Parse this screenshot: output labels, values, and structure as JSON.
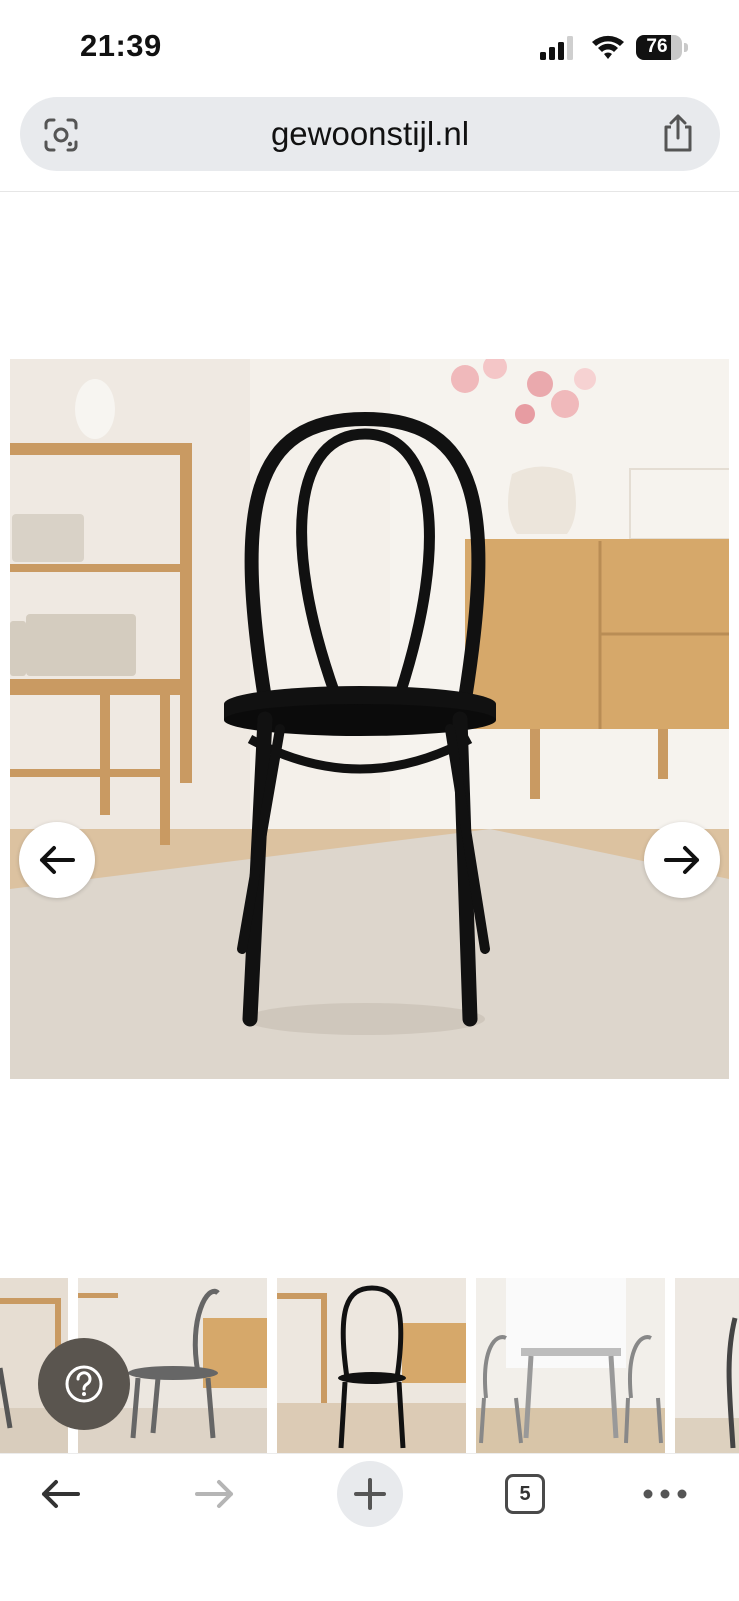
{
  "status_bar": {
    "time": "21:39",
    "battery_level": "76",
    "battery_fraction": 0.76
  },
  "address_bar": {
    "url": "gewoonstijl.nl"
  },
  "product": {
    "image_alt": "Black bentwood dining chair in living room",
    "gallery_prev_icon": "arrow-left-icon",
    "gallery_next_icon": "arrow-right-icon"
  },
  "thumbnails": {
    "count_visible": 5,
    "selected_index": 2
  },
  "help": {
    "icon": "question-icon"
  },
  "toolbar": {
    "tab_count": "5"
  },
  "colors": {
    "address_bg": "#e8eaed",
    "help_bg": "#5a554f",
    "chair": "#111111",
    "wood": "#d6a86a",
    "rug": "#ddd6cc"
  }
}
